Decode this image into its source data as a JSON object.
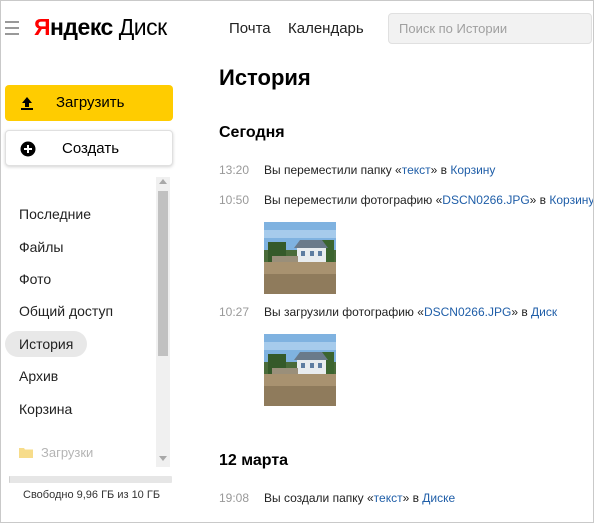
{
  "header": {
    "logo_yandex": "Яндекс",
    "logo_disk": "Диск",
    "nav": [
      "Почта",
      "Календарь"
    ],
    "search_placeholder": "Поиск по Истории",
    "search_value": ""
  },
  "sidebar": {
    "upload_label": "Загрузить",
    "create_label": "Создать",
    "items": [
      {
        "label": "Последние"
      },
      {
        "label": "Файлы"
      },
      {
        "label": "Фото"
      },
      {
        "label": "Общий доступ"
      },
      {
        "label": "История",
        "active": true
      },
      {
        "label": "Архив"
      },
      {
        "label": "Корзина"
      }
    ],
    "folder_label": "Загрузки",
    "quota_text": "Свободно 9,96 ГБ из 10 ГБ",
    "quota_used_fraction": 0.004
  },
  "main": {
    "title": "История",
    "sections": [
      {
        "date": "Сегодня",
        "events": [
          {
            "time": "13:20",
            "prefix": "Вы переместили папку «",
            "item": "текст",
            "middle": "» в ",
            "target": "Корзину"
          },
          {
            "time": "10:50",
            "prefix": "Вы переместили фотографию «",
            "item": "DSCN0266.JPG",
            "middle": "» в ",
            "target": "Корзину"
          },
          {
            "time": "10:27",
            "prefix": "Вы загрузили фотографию «",
            "item": "DSCN0266.JPG",
            "middle": "» в ",
            "target": "Диск"
          }
        ]
      },
      {
        "date": "12 марта",
        "events": [
          {
            "time": "19:08",
            "prefix": "Вы создали папку «",
            "item": "текст",
            "middle": "» в ",
            "target": "Диске"
          }
        ]
      }
    ]
  },
  "colors": {
    "accent_yellow": "#ffcc00",
    "logo_red": "#ff0000",
    "link_blue": "#1f5ea8"
  }
}
